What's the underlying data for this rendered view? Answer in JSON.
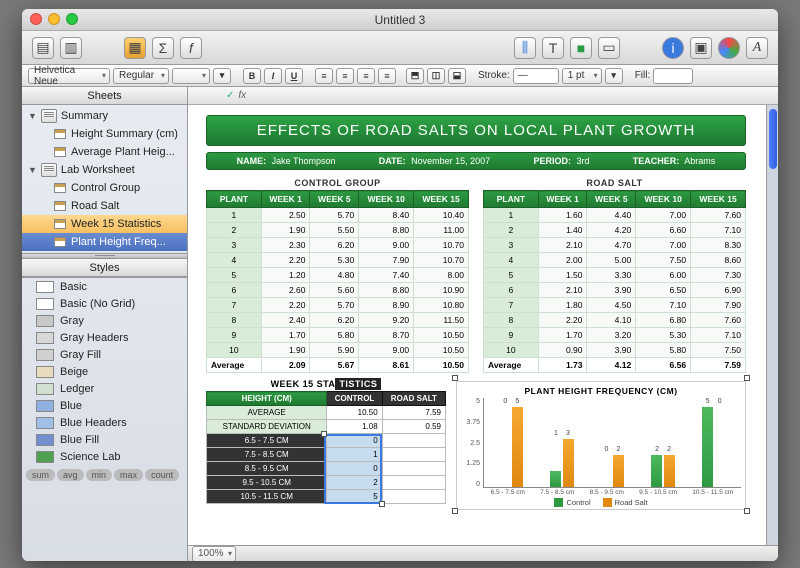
{
  "window_title": "Untitled 3",
  "toolbar": {
    "font_family": "Helvetica Neue",
    "font_style": "Regular",
    "font_size": "",
    "stroke_label": "Stroke:",
    "stroke_pt": "1 pt",
    "fill_label": "Fill:"
  },
  "sidebar": {
    "sheets_title": "Sheets",
    "groups": [
      {
        "name": "Summary",
        "items": [
          {
            "label": "Height Summary (cm)"
          },
          {
            "label": "Average Plant Heig..."
          }
        ]
      },
      {
        "name": "Lab Worksheet",
        "items": [
          {
            "label": "Control Group"
          },
          {
            "label": "Road Salt"
          },
          {
            "label": "Week 15 Statistics",
            "highlight": true
          },
          {
            "label": "Plant Height Freq...",
            "selected": true
          }
        ]
      }
    ],
    "styles_title": "Styles",
    "styles": [
      {
        "label": "Basic",
        "bg": "#fff"
      },
      {
        "label": "Basic (No Grid)",
        "bg": "#fff"
      },
      {
        "label": "Gray",
        "bg": "#c8c8c8"
      },
      {
        "label": "Gray Headers",
        "bg": "#d8d8d8"
      },
      {
        "label": "Gray Fill",
        "bg": "#d0d0d0"
      },
      {
        "label": "Beige",
        "bg": "#e8dcc0"
      },
      {
        "label": "Ledger",
        "bg": "#d0e0d0"
      },
      {
        "label": "Blue",
        "bg": "#90b0e0"
      },
      {
        "label": "Blue Headers",
        "bg": "#a0c0e8"
      },
      {
        "label": "Blue Fill",
        "bg": "#7090d0"
      },
      {
        "label": "Science Lab",
        "bg": "#4fa050"
      }
    ],
    "pills": [
      "sum",
      "avg",
      "min",
      "max",
      "count"
    ]
  },
  "fxbar": {
    "fx_label": "fx"
  },
  "doc": {
    "banner": "EFFECTS OF ROAD SALTS ON LOCAL PLANT GROWTH",
    "meta": [
      {
        "k": "NAME:",
        "v": "Jake Thompson"
      },
      {
        "k": "DATE:",
        "v": "November 15, 2007"
      },
      {
        "k": "PERIOD:",
        "v": "3rd"
      },
      {
        "k": "TEACHER:",
        "v": "Abrams"
      }
    ],
    "tables": {
      "control": {
        "title": "CONTROL GROUP",
        "headers": [
          "PLANT",
          "WEEK 1",
          "WEEK 5",
          "WEEK 10",
          "WEEK 15"
        ],
        "rows": [
          [
            "1",
            "2.50",
            "5.70",
            "8.40",
            "10.40"
          ],
          [
            "2",
            "1.90",
            "5.50",
            "8.80",
            "11.00"
          ],
          [
            "3",
            "2.30",
            "6.20",
            "9.00",
            "10.70"
          ],
          [
            "4",
            "2.20",
            "5.30",
            "7.90",
            "10.70"
          ],
          [
            "5",
            "1.20",
            "4.80",
            "7.40",
            "8.00"
          ],
          [
            "6",
            "2.60",
            "5.60",
            "8.80",
            "10.90"
          ],
          [
            "7",
            "2.20",
            "5.70",
            "8.90",
            "10.80"
          ],
          [
            "8",
            "2.40",
            "6.20",
            "9.20",
            "11.50"
          ],
          [
            "9",
            "1.70",
            "5.80",
            "8.70",
            "10.50"
          ],
          [
            "10",
            "1.90",
            "5.90",
            "9.00",
            "10.50"
          ]
        ],
        "avg": [
          "Average",
          "2.09",
          "5.67",
          "8.61",
          "10.50"
        ]
      },
      "roadsalt": {
        "title": "ROAD SALT",
        "headers": [
          "PLANT",
          "WEEK 1",
          "WEEK 5",
          "WEEK 10",
          "WEEK 15"
        ],
        "rows": [
          [
            "1",
            "1.60",
            "4.40",
            "7.00",
            "7.60"
          ],
          [
            "2",
            "1.40",
            "4.20",
            "6.60",
            "7.10"
          ],
          [
            "3",
            "2.10",
            "4.70",
            "7.00",
            "8.30"
          ],
          [
            "4",
            "2.00",
            "5.00",
            "7.50",
            "8.60"
          ],
          [
            "5",
            "1.50",
            "3.30",
            "6.00",
            "7.30"
          ],
          [
            "6",
            "2.10",
            "3.90",
            "6.50",
            "6.90"
          ],
          [
            "7",
            "1.80",
            "4.50",
            "7.10",
            "7.90"
          ],
          [
            "8",
            "2.20",
            "4.10",
            "6.80",
            "7.60"
          ],
          [
            "9",
            "1.70",
            "3.20",
            "5.30",
            "7.10"
          ],
          [
            "10",
            "0.90",
            "3.90",
            "5.80",
            "7.50"
          ]
        ],
        "avg": [
          "Average",
          "1.73",
          "4.12",
          "6.56",
          "7.59"
        ]
      }
    },
    "stats": {
      "title_a": "WEEK 15 STA",
      "title_b": "TISTICS",
      "headers": [
        "HEIGHT (CM)",
        "CONTROL",
        "ROAD SALT"
      ],
      "rows": [
        [
          "AVERAGE",
          "10.50",
          "7.59"
        ],
        [
          "STANDARD DEVIATION",
          "1.08",
          "0.59"
        ],
        [
          "6.5 - 7.5 CM",
          "0",
          ""
        ],
        [
          "7.5 - 8.5 CM",
          "1",
          ""
        ],
        [
          "8.5 - 9.5 CM",
          "0",
          ""
        ],
        [
          "9.5 - 10.5 CM",
          "2",
          ""
        ],
        [
          "10.5 - 11.5 CM",
          "5",
          ""
        ]
      ]
    }
  },
  "chart_data": {
    "type": "bar",
    "title": "PLANT HEIGHT FREQUENCY (CM)",
    "categories": [
      "6.5 - 7.5 cm",
      "7.5 - 8.5 cm",
      "8.5 - 9.5 cm",
      "9.5 - 10.5 cm",
      "10.5 - 11.5 cm"
    ],
    "series": [
      {
        "name": "Control",
        "values": [
          0,
          1,
          0,
          2,
          5
        ]
      },
      {
        "name": "Road Salt",
        "values": [
          5,
          3,
          2,
          2,
          0
        ]
      }
    ],
    "ylim": [
      0,
      5
    ],
    "yticks": [
      "0",
      "1.25",
      "2.5",
      "3.75",
      "5"
    ]
  },
  "zoom": "100%"
}
